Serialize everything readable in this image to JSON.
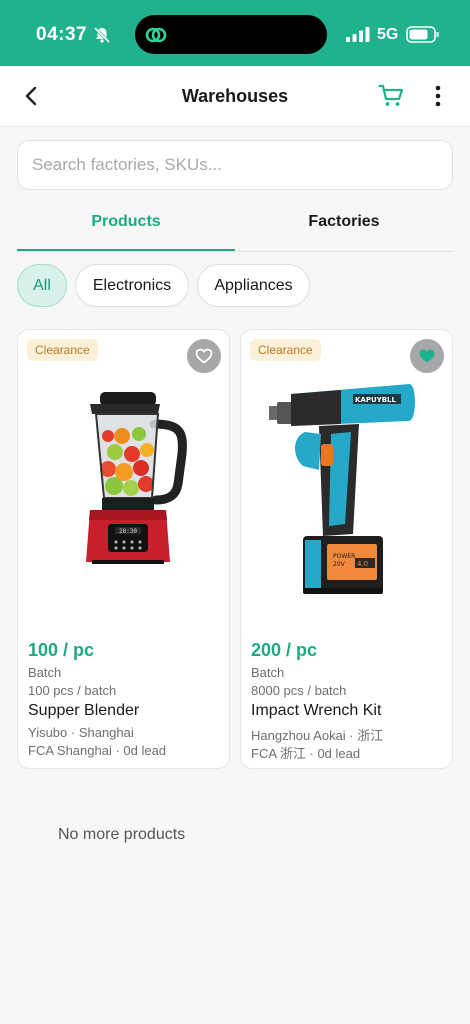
{
  "status_bar": {
    "time": "04:37",
    "network": "5G",
    "icons": [
      "bell-muted-icon",
      "app-indicator-icon",
      "signal-icon",
      "battery-icon"
    ]
  },
  "header": {
    "title": "Warehouses",
    "icons": [
      "back-icon",
      "cart-icon",
      "more-vertical-icon"
    ]
  },
  "search": {
    "placeholder": "Search factories, SKUs..."
  },
  "tabs": [
    {
      "label": "Products",
      "active": true
    },
    {
      "label": "Factories",
      "active": false
    }
  ],
  "filters": [
    {
      "label": "All",
      "active": true
    },
    {
      "label": "Electronics",
      "active": false
    },
    {
      "label": "Appliances",
      "active": false
    }
  ],
  "products": [
    {
      "badge": "Clearance",
      "favorited": false,
      "image": "blender",
      "price": "100 / pc",
      "unit_type": "Batch",
      "batch_size": "100 pcs / batch",
      "name": "Supper Blender",
      "supplier": "Yisubo · Shanghai",
      "shipping": "FCA Shanghai · 0d lead"
    },
    {
      "badge": "Clearance",
      "favorited": true,
      "image": "impact-wrench",
      "price": "200 / pc",
      "unit_type": "Batch",
      "batch_size": "8000 pcs / batch",
      "name": "Impact Wrench Kit",
      "supplier": "Hangzhou Aokai · 浙江",
      "shipping": "FCA 浙江 · 0d lead"
    }
  ],
  "footer_note": "No more products",
  "colors": {
    "brand": "#1fb28c",
    "accent_text": "#1fa884",
    "badge_bg": "#fdf0d8",
    "badge_text": "#b57a24"
  }
}
